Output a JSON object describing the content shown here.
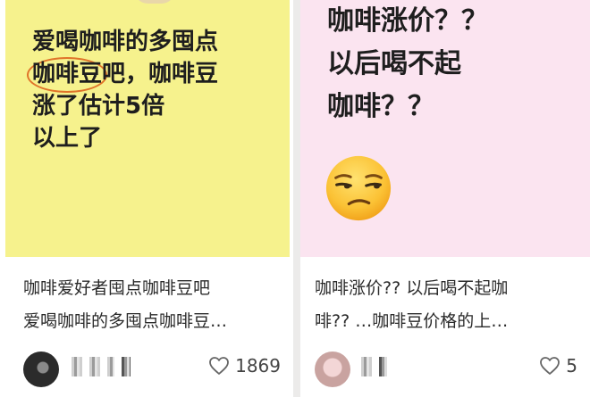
{
  "cards": [
    {
      "cover_lines": [
        "爱喝咖啡的多囤点",
        "咖啡豆",
        "吧，咖啡豆",
        "涨了估计5倍",
        "以上了"
      ],
      "caption_lines": [
        "咖啡爱好者囤点咖啡豆吧",
        "爱喝咖啡的多囤点咖啡豆…"
      ],
      "likes": "1869",
      "icons": {
        "like": "heart-outline-icon"
      }
    },
    {
      "cover_lines": [
        "咖啡涨价？？",
        "以后喝不起",
        "咖啡？？"
      ],
      "caption_lines": [
        "咖啡涨价?? 以后喝不起咖",
        "啡?? …咖啡豆价格的上…"
      ],
      "likes": "5",
      "icons": {
        "like": "heart-outline-icon",
        "emoji": "unamused-face-emoji"
      }
    }
  ],
  "colors": {
    "left_cover": "#f6f28d",
    "right_cover": "#fbe4f0",
    "circle_highlight": "#e0742a"
  }
}
